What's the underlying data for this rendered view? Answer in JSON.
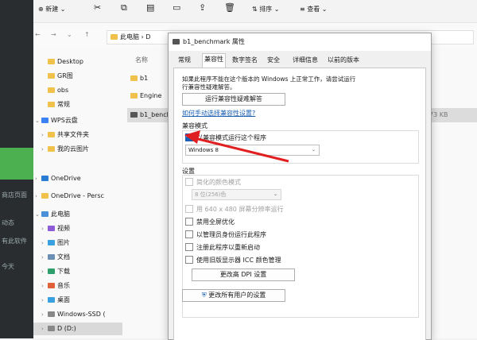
{
  "toolbar": {
    "new_label": "新建",
    "sort_label": "排序",
    "view_label": "查看"
  },
  "address": {
    "path": "此电脑 › D"
  },
  "nav": {
    "items": [
      {
        "label": "Desktop"
      },
      {
        "label": "GR图"
      },
      {
        "label": "obs"
      },
      {
        "label": "常规"
      },
      {
        "label": "WPS云盘"
      },
      {
        "label": "共享文件夹"
      },
      {
        "label": "我的云图片"
      },
      {
        "label": "OneDrive"
      },
      {
        "label": "OneDrive - Persc"
      },
      {
        "label": "此电脑"
      },
      {
        "label": "视频"
      },
      {
        "label": "图片"
      },
      {
        "label": "文档"
      },
      {
        "label": "下载"
      },
      {
        "label": "音乐"
      },
      {
        "label": "桌面"
      },
      {
        "label": "Windows-SSD ("
      },
      {
        "label": "D (D:)"
      }
    ]
  },
  "files": {
    "header_name": "名称",
    "items": [
      {
        "name": "b1"
      },
      {
        "name": "Engine"
      },
      {
        "name": "b1_bench"
      }
    ],
    "size_text": "73 KB"
  },
  "bgapp": {
    "texts": [
      "商店页面",
      "动态",
      "有此软件",
      "今天"
    ]
  },
  "dialog": {
    "title": "b1_benchmark 属性",
    "tabs": [
      "常规",
      "兼容性",
      "数字签名",
      "安全",
      "详细信息",
      "以前的版本"
    ],
    "intro_line1": "如果此程序不能在这个版本的 Windows 上正常工作，请尝试运行",
    "intro_line2": "行兼容性疑难解答。",
    "troubleshoot_btn": "运行兼容性疑难解答",
    "manual_link": "如何手动选择兼容性设置?",
    "compat_mode_title": "兼容模式",
    "compat_mode_checkbox": "以兼容模式运行这个程序",
    "compat_mode_select": "Windows 8",
    "settings_title": "设置",
    "reduced_color": "简化的颜色模式",
    "color_select": "8 位(256)色",
    "res_640": "用 640 x 480 屏幕分辨率运行",
    "disable_fullscreen": "禁用全屏优化",
    "run_as_admin": "以管理员身份运行此程序",
    "register_restart": "注册此程序以重新启动",
    "icc_color": "使用旧版显示器 ICC 颜色管理",
    "dpi_btn": "更改高 DPI 设置",
    "all_users_btn": "更改所有用户的设置"
  },
  "colors": {
    "accent": "#1a5fb4",
    "annotation_red": "#e02020"
  }
}
